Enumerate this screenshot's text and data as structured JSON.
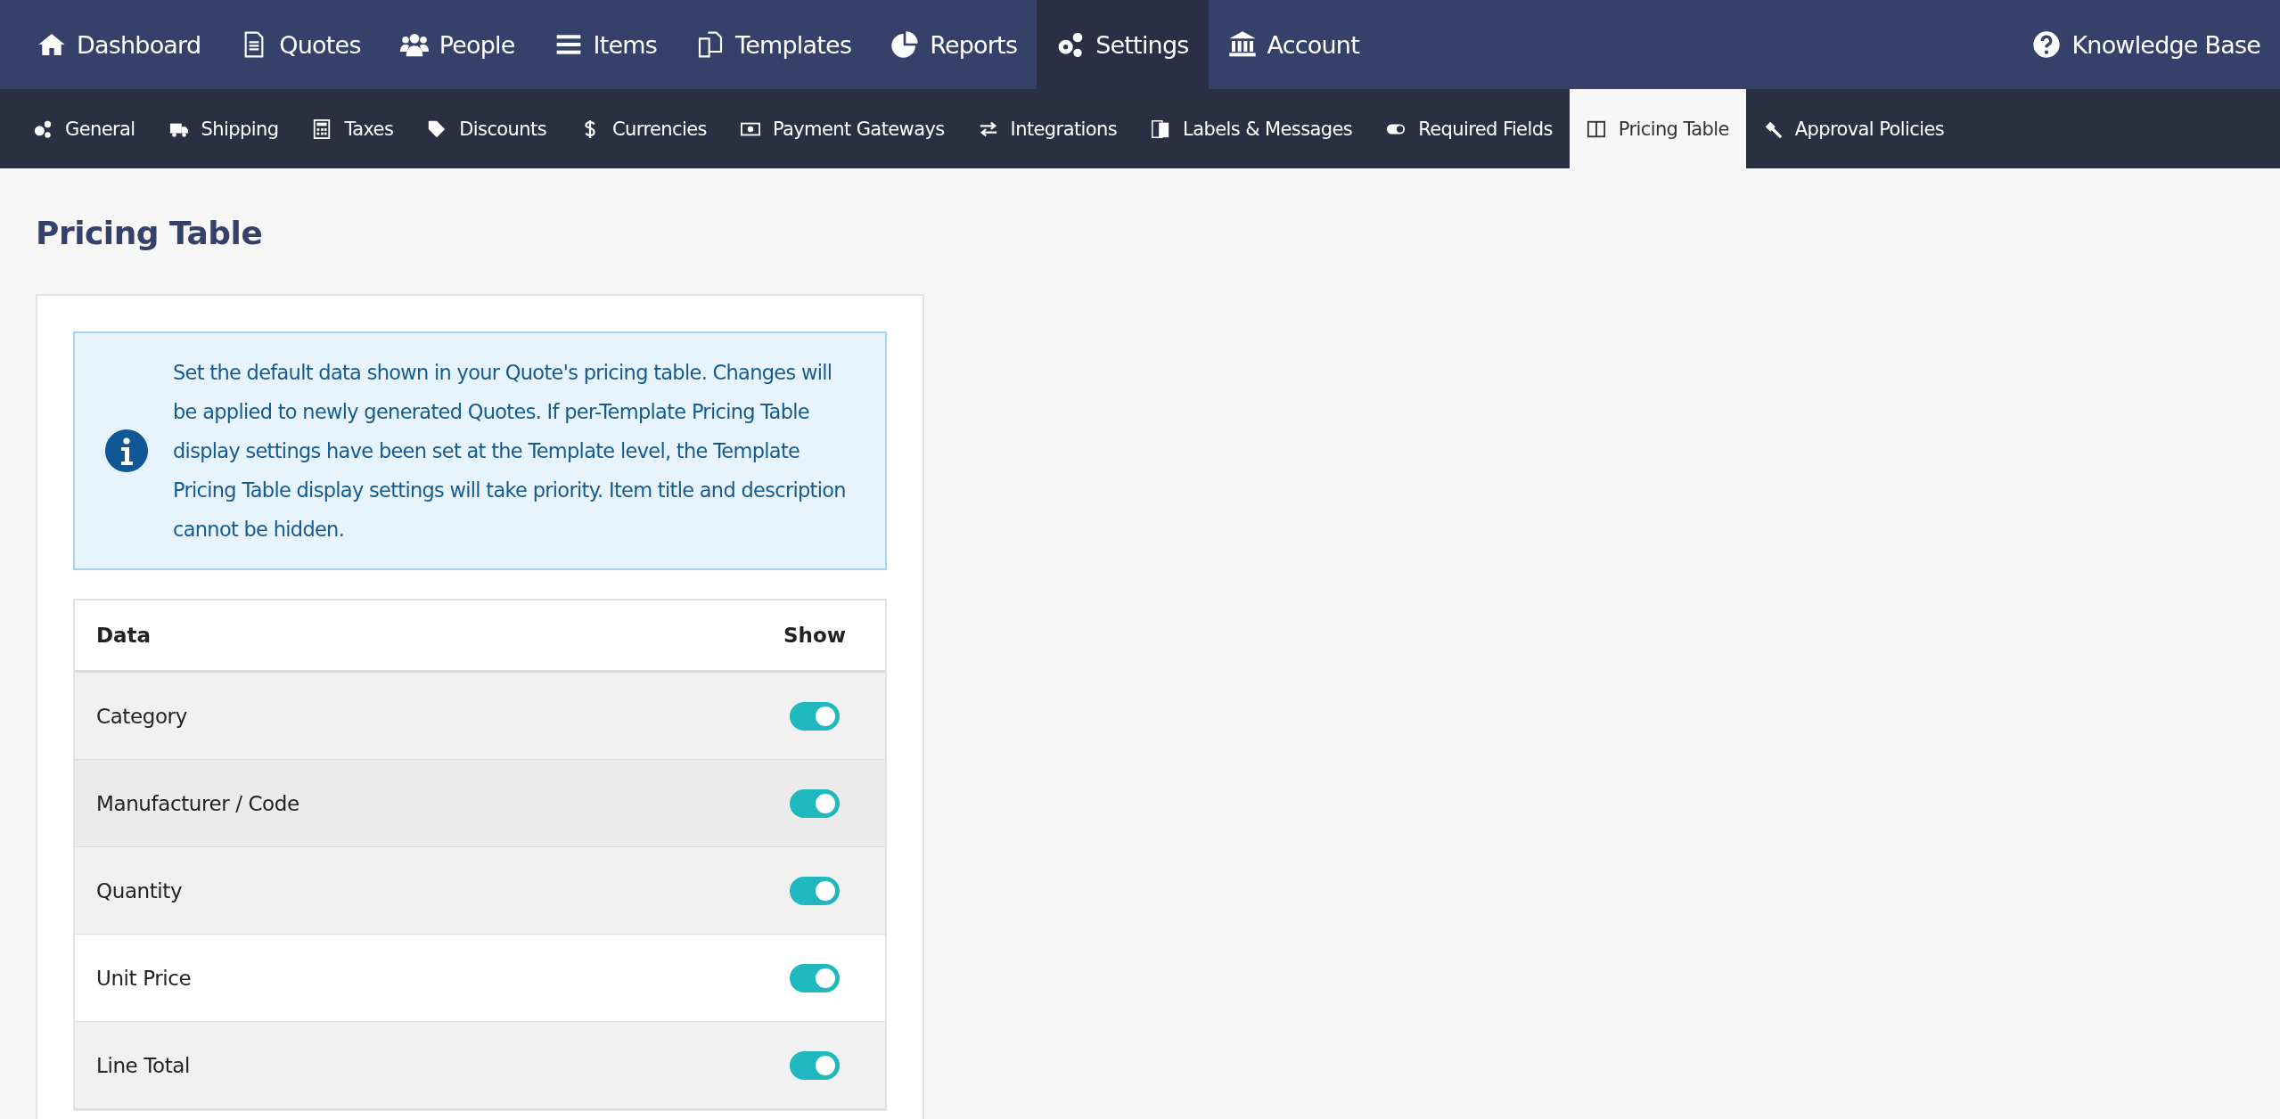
{
  "main_nav": {
    "items": [
      {
        "label": "Dashboard",
        "selected": false
      },
      {
        "label": "Quotes",
        "selected": false
      },
      {
        "label": "People",
        "selected": false
      },
      {
        "label": "Items",
        "selected": false
      },
      {
        "label": "Templates",
        "selected": false
      },
      {
        "label": "Reports",
        "selected": false
      },
      {
        "label": "Settings",
        "selected": true
      },
      {
        "label": "Account",
        "selected": false
      }
    ],
    "help_link": "Knowledge Base"
  },
  "settings_tabs": [
    {
      "label": "General",
      "selected": false
    },
    {
      "label": "Shipping",
      "selected": false
    },
    {
      "label": "Taxes",
      "selected": false
    },
    {
      "label": "Discounts",
      "selected": false
    },
    {
      "label": "Currencies",
      "selected": false
    },
    {
      "label": "Payment Gateways",
      "selected": false
    },
    {
      "label": "Integrations",
      "selected": false
    },
    {
      "label": "Labels & Messages",
      "selected": false
    },
    {
      "label": "Required Fields",
      "selected": false
    },
    {
      "label": "Pricing Table",
      "selected": true
    },
    {
      "label": "Approval Policies",
      "selected": false
    }
  ],
  "page_title": "Pricing Table",
  "info_message": "Set the default data shown in your Quote's pricing table. Changes will be applied to newly generated Quotes. If per-Template Pricing Table display settings have been set at the Template level, the Template Pricing Table display settings will take priority. Item title and description cannot be hidden.",
  "table": {
    "columns": [
      "Data",
      "Show"
    ],
    "rows": [
      {
        "label": "Category",
        "on": true,
        "hovered": false,
        "shaded": true
      },
      {
        "label": "Manufacturer / Code",
        "on": true,
        "hovered": true,
        "shaded": true
      },
      {
        "label": "Quantity",
        "on": true,
        "hovered": false,
        "shaded": true
      },
      {
        "label": "Unit Price",
        "on": true,
        "hovered": false,
        "shaded": false
      },
      {
        "label": "Line Total",
        "on": true,
        "hovered": false,
        "shaded": true
      }
    ]
  }
}
